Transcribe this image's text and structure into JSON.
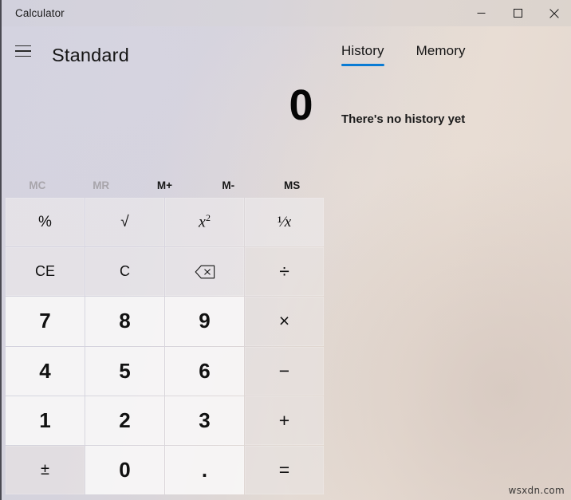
{
  "window": {
    "title": "Calculator",
    "controls": {
      "minimize": "minimize-icon",
      "maximize": "maximize-icon",
      "close": "close-icon"
    }
  },
  "header": {
    "menu_icon": "hamburger-menu-icon",
    "mode": "Standard"
  },
  "tabs": [
    {
      "label": "History",
      "active": true
    },
    {
      "label": "Memory",
      "active": false
    }
  ],
  "display": {
    "value": "0"
  },
  "history": {
    "empty_message": "There's no history yet"
  },
  "memory_buttons": [
    {
      "label": "MC",
      "enabled": false
    },
    {
      "label": "MR",
      "enabled": false
    },
    {
      "label": "M+",
      "enabled": true
    },
    {
      "label": "M-",
      "enabled": true
    },
    {
      "label": "MS",
      "enabled": true
    }
  ],
  "keypad": [
    {
      "label": "%",
      "name": "percent-button",
      "kind": "func"
    },
    {
      "label": "√",
      "name": "square-root-button",
      "kind": "func"
    },
    {
      "label": "x2",
      "name": "square-button",
      "kind": "func-sup"
    },
    {
      "label": "1/x",
      "name": "reciprocal-button",
      "kind": "func-frac"
    },
    {
      "label": "CE",
      "name": "clear-entry-button",
      "kind": "func-small"
    },
    {
      "label": "C",
      "name": "clear-button",
      "kind": "func-small"
    },
    {
      "label": "⌫",
      "name": "backspace-button",
      "kind": "func-icon"
    },
    {
      "label": "÷",
      "name": "divide-button",
      "kind": "op"
    },
    {
      "label": "7",
      "name": "seven-button",
      "kind": "num"
    },
    {
      "label": "8",
      "name": "eight-button",
      "kind": "num"
    },
    {
      "label": "9",
      "name": "nine-button",
      "kind": "num"
    },
    {
      "label": "×",
      "name": "multiply-button",
      "kind": "op"
    },
    {
      "label": "4",
      "name": "four-button",
      "kind": "num"
    },
    {
      "label": "5",
      "name": "five-button",
      "kind": "num"
    },
    {
      "label": "6",
      "name": "six-button",
      "kind": "num"
    },
    {
      "label": "−",
      "name": "subtract-button",
      "kind": "op"
    },
    {
      "label": "1",
      "name": "one-button",
      "kind": "num"
    },
    {
      "label": "2",
      "name": "two-button",
      "kind": "num"
    },
    {
      "label": "3",
      "name": "three-button",
      "kind": "num"
    },
    {
      "label": "+",
      "name": "add-button",
      "kind": "op"
    },
    {
      "label": "±",
      "name": "plus-minus-button",
      "kind": "sign"
    },
    {
      "label": "0",
      "name": "zero-button",
      "kind": "num"
    },
    {
      "label": ".",
      "name": "decimal-button",
      "kind": "num"
    },
    {
      "label": "=",
      "name": "equals-button",
      "kind": "op"
    }
  ],
  "watermark": "wsxdn.com",
  "colors": {
    "accent": "#0a7bd4",
    "text": "#141414",
    "disabled_text": "#a8a5ab"
  }
}
